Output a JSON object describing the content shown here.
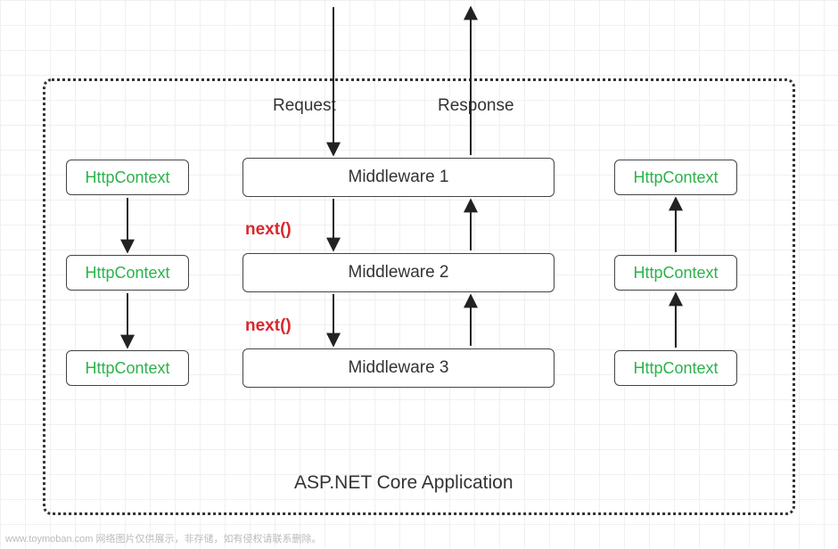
{
  "labels": {
    "request": "Request",
    "response": "Response",
    "next1": "next()",
    "next2": "next()",
    "caption": "ASP.NET Core Application",
    "footer": "www.toymoban.com 网络图片仅供展示，非存储，如有侵权请联系删除。"
  },
  "httpContext": {
    "left1": "HttpContext",
    "left2": "HttpContext",
    "left3": "HttpContext",
    "right1": "HttpContext",
    "right2": "HttpContext",
    "right3": "HttpContext"
  },
  "middleware": {
    "mw1": "Middleware 1",
    "mw2": "Middleware 2",
    "mw3": "Middleware 3"
  },
  "chart_data": {
    "type": "diagram",
    "title": "ASP.NET Core Application",
    "nodes": [
      {
        "id": "mw1",
        "label": "Middleware 1",
        "type": "middleware"
      },
      {
        "id": "mw2",
        "label": "Middleware 2",
        "type": "middleware"
      },
      {
        "id": "mw3",
        "label": "Middleware 3",
        "type": "middleware"
      },
      {
        "id": "hL1",
        "label": "HttpContext",
        "type": "context",
        "side": "left"
      },
      {
        "id": "hL2",
        "label": "HttpContext",
        "type": "context",
        "side": "left"
      },
      {
        "id": "hL3",
        "label": "HttpContext",
        "type": "context",
        "side": "left"
      },
      {
        "id": "hR1",
        "label": "HttpContext",
        "type": "context",
        "side": "right"
      },
      {
        "id": "hR2",
        "label": "HttpContext",
        "type": "context",
        "side": "right"
      },
      {
        "id": "hR3",
        "label": "HttpContext",
        "type": "context",
        "side": "right"
      }
    ],
    "edges": [
      {
        "from": "external",
        "to": "mw1",
        "label": "Request"
      },
      {
        "from": "mw1",
        "to": "external",
        "label": "Response"
      },
      {
        "from": "mw1",
        "to": "mw2",
        "label": "next()",
        "direction": "down"
      },
      {
        "from": "mw2",
        "to": "mw3",
        "label": "next()",
        "direction": "down"
      },
      {
        "from": "mw2",
        "to": "mw1",
        "direction": "up"
      },
      {
        "from": "mw3",
        "to": "mw2",
        "direction": "up"
      },
      {
        "from": "hL1",
        "to": "hL2",
        "direction": "down"
      },
      {
        "from": "hL2",
        "to": "hL3",
        "direction": "down"
      },
      {
        "from": "hR3",
        "to": "hR2",
        "direction": "up"
      },
      {
        "from": "hR2",
        "to": "hR1",
        "direction": "up"
      }
    ]
  }
}
